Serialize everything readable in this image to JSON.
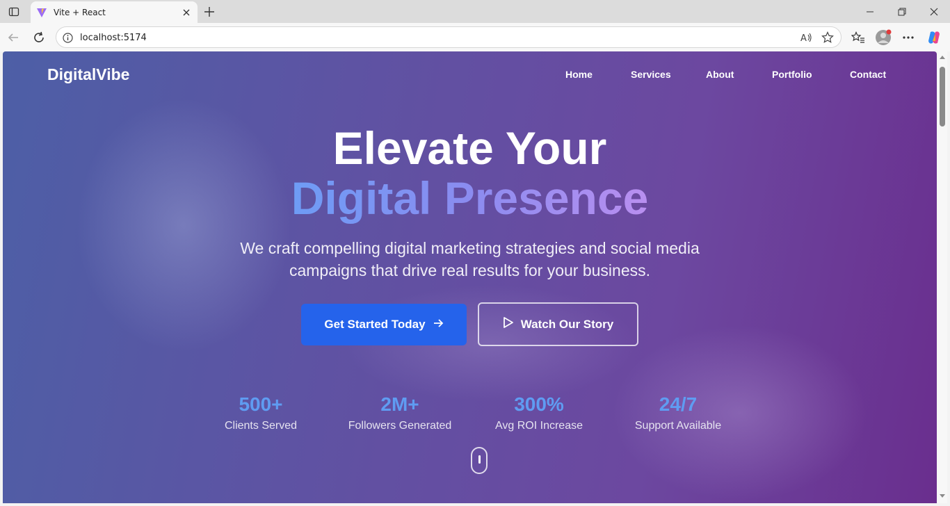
{
  "browser": {
    "tab_title": "Vite + React",
    "url": "localhost:5174"
  },
  "site": {
    "brand": "DigitalVibe",
    "nav": [
      "Home",
      "Services",
      "About",
      "Portfolio",
      "Contact"
    ],
    "hero": {
      "line1": "Elevate Your",
      "line2": "Digital Presence",
      "subtitle": "We craft compelling digital marketing strategies and social media campaigns that drive real results for your business.",
      "primary_cta": "Get Started Today",
      "secondary_cta": "Watch Our Story"
    },
    "stats": [
      {
        "value": "500+",
        "label": "Clients Served"
      },
      {
        "value": "2M+",
        "label": "Followers Generated"
      },
      {
        "value": "300%",
        "label": "Avg ROI Increase"
      },
      {
        "value": "24/7",
        "label": "Support Available"
      }
    ]
  },
  "colors": {
    "primary_button": "#2563eb",
    "stat_value": "#5f9cf2",
    "hero_gradient": [
      "#6e9cf5",
      "#b98ff0"
    ]
  }
}
